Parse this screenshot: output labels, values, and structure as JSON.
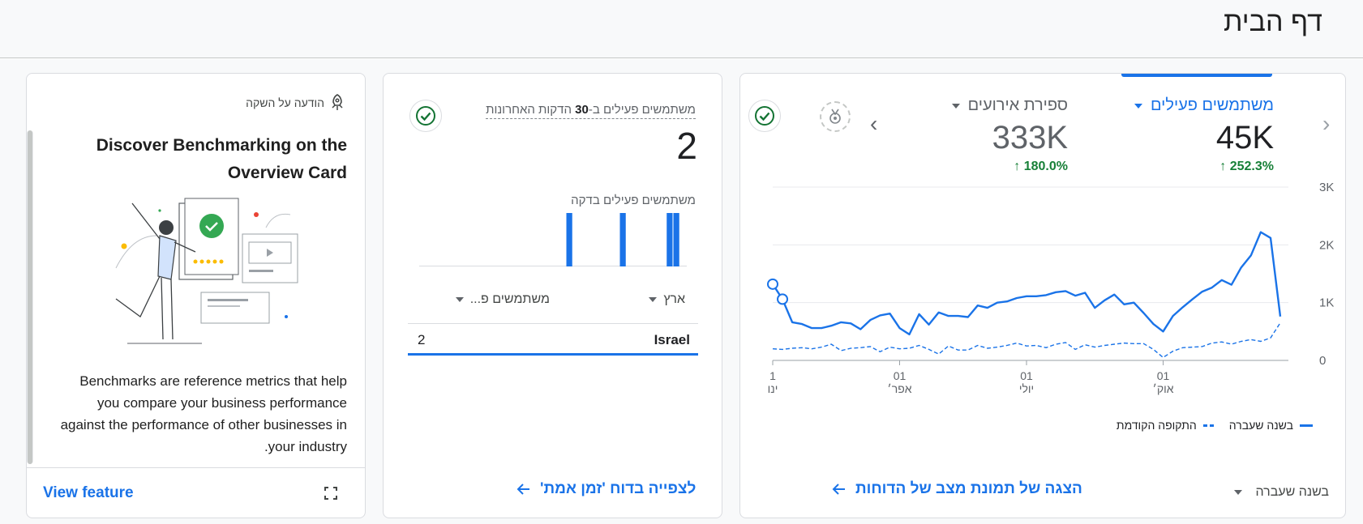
{
  "page": {
    "title": "דף הבית"
  },
  "announcement": {
    "header": "הודעה על השקה",
    "title": "Discover Benchmarking on the Overview Card",
    "body": "Benchmarks are reference metrics that help you compare your business performance against the performance of other businesses in your industry.",
    "cta": "View feature",
    "icon": "rocket-icon"
  },
  "realtime": {
    "label_prefix": "משתמשים פעילים ב-",
    "label_bold": "30",
    "label_suffix": " הדקות האחרונות",
    "value": "2",
    "per_minute_label": "משתמשים פעילים בדקה",
    "per_minute_values": [
      0,
      0,
      0,
      0,
      0,
      0,
      0,
      0,
      0,
      0,
      0,
      0,
      0,
      0,
      0,
      0,
      0,
      0,
      0,
      0,
      0,
      0,
      1,
      0,
      0,
      0,
      0,
      0,
      0,
      0,
      1,
      0,
      0,
      0,
      0,
      0,
      0,
      1,
      1,
      0
    ],
    "columns": {
      "country": "ארץ",
      "users": "משתמשים פ..."
    },
    "rows": [
      {
        "country": "Israel",
        "users": "2"
      }
    ],
    "footer_link": "לצפייה בדוח 'זמן אמת'"
  },
  "overview": {
    "metric1": {
      "label": "משתמשים פעילים",
      "value": "45K",
      "delta": "252.3%"
    },
    "metric2": {
      "label": "ספירת אירועים",
      "value": "333K",
      "delta": "180.0%"
    },
    "legend": {
      "current": "בשנה שעברה",
      "previous": "התקופה הקודמת"
    },
    "footer_link": "הצגה של תמונת מצב של הדוחות",
    "period": "בשנה שעברה",
    "accent": "#1a73e8",
    "positive": "#188038"
  },
  "chart_data": {
    "type": "line",
    "y_ticks": [
      "3K",
      "2K",
      "1K",
      "0"
    ],
    "x_ticks": [
      {
        "day": "1",
        "month": "ינו"
      },
      {
        "day": "01",
        "month": "אפר׳"
      },
      {
        "day": "01",
        "month": "יולי"
      },
      {
        "day": "01",
        "month": "אוק׳"
      }
    ],
    "ylim": [
      0,
      3000
    ],
    "series": [
      {
        "name": "בשנה שעברה",
        "style": "solid",
        "values": [
          1320,
          1060,
          660,
          630,
          560,
          560,
          600,
          660,
          640,
          540,
          700,
          780,
          810,
          560,
          450,
          800,
          620,
          830,
          770,
          770,
          750,
          950,
          910,
          1000,
          1020,
          1080,
          1110,
          1110,
          1130,
          1180,
          1200,
          1120,
          1170,
          910,
          1040,
          1140,
          970,
          1000,
          820,
          630,
          500,
          770,
          920,
          1060,
          1190,
          1260,
          1390,
          1310,
          1610,
          1820,
          2220,
          2120,
          760
        ]
      },
      {
        "name": "התקופה הקודמת",
        "style": "dashed",
        "values": [
          200,
          190,
          210,
          220,
          200,
          230,
          280,
          170,
          210,
          220,
          240,
          150,
          230,
          200,
          210,
          260,
          190,
          110,
          250,
          180,
          180,
          260,
          210,
          230,
          260,
          300,
          250,
          260,
          220,
          280,
          310,
          190,
          270,
          230,
          260,
          280,
          300,
          290,
          290,
          190,
          50,
          160,
          220,
          230,
          240,
          300,
          320,
          280,
          330,
          360,
          330,
          390,
          650
        ]
      }
    ]
  }
}
